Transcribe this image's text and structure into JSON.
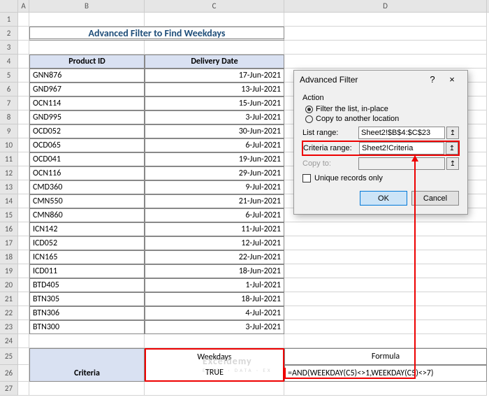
{
  "columns": [
    "A",
    "B",
    "C",
    "D"
  ],
  "title": "Advanced Filter to Find Weekdays",
  "table": {
    "headers": {
      "b": "Product ID",
      "c": "Delivery Date"
    },
    "rows": [
      {
        "n": 5,
        "b": "GNN876",
        "c": "17-Jun-2021"
      },
      {
        "n": 6,
        "b": "GND967",
        "c": "13-Jul-2021"
      },
      {
        "n": 7,
        "b": "OCN114",
        "c": "15-Jun-2021"
      },
      {
        "n": 8,
        "b": "GND995",
        "c": "3-Jul-2021"
      },
      {
        "n": 9,
        "b": "OCD052",
        "c": "30-Jun-2021"
      },
      {
        "n": 10,
        "b": "OCD065",
        "c": "6-Jul-2021"
      },
      {
        "n": 11,
        "b": "OCD041",
        "c": "19-Jun-2021"
      },
      {
        "n": 12,
        "b": "OCN116",
        "c": "29-Jun-2021"
      },
      {
        "n": 13,
        "b": "CMD360",
        "c": "9-Jul-2021"
      },
      {
        "n": 14,
        "b": "CMN550",
        "c": "21-Jun-2021"
      },
      {
        "n": 15,
        "b": "CMN860",
        "c": "6-Jul-2021"
      },
      {
        "n": 16,
        "b": "ICN142",
        "c": "11-Jul-2021"
      },
      {
        "n": 17,
        "b": "ICD052",
        "c": "12-Jul-2021"
      },
      {
        "n": 18,
        "b": "ICN165",
        "c": "22-Jun-2021"
      },
      {
        "n": 19,
        "b": "ICD011",
        "c": "18-Jun-2021"
      },
      {
        "n": 20,
        "b": "BTD405",
        "c": "1-Jul-2021"
      },
      {
        "n": 21,
        "b": "BTN305",
        "c": "18-Jul-2021"
      },
      {
        "n": 22,
        "b": "BTN306",
        "c": "4-Jul-2021"
      },
      {
        "n": 23,
        "b": "BTN300",
        "c": "3-Jul-2021"
      }
    ]
  },
  "criteria_section": {
    "label": "Criteria",
    "head_c": "Weekdays",
    "head_d": "Formula",
    "val_c": "TRUE",
    "val_d": "=AND(WEEKDAY(C5)<>1,WEEKDAY(C5)<>7)"
  },
  "dialog": {
    "title": "Advanced Filter",
    "help": "?",
    "close": "×",
    "action_label": "Action",
    "radio1": "Filter the list, in-place",
    "radio2": "Copy to another location",
    "list_range_label": "List range:",
    "list_range_value": "Sheet2!$B$4:$C$23",
    "criteria_range_label": "Criteria range:",
    "criteria_range_value": "Sheet2!Criteria",
    "copy_to_label": "Copy to:",
    "copy_to_value": "",
    "unique_label": "Unique records only",
    "ok": "OK",
    "cancel": "Cancel",
    "ref_icon": "↥"
  },
  "watermark": {
    "big": "Exceldemy",
    "small": "EXCEL · DATA · EX"
  }
}
